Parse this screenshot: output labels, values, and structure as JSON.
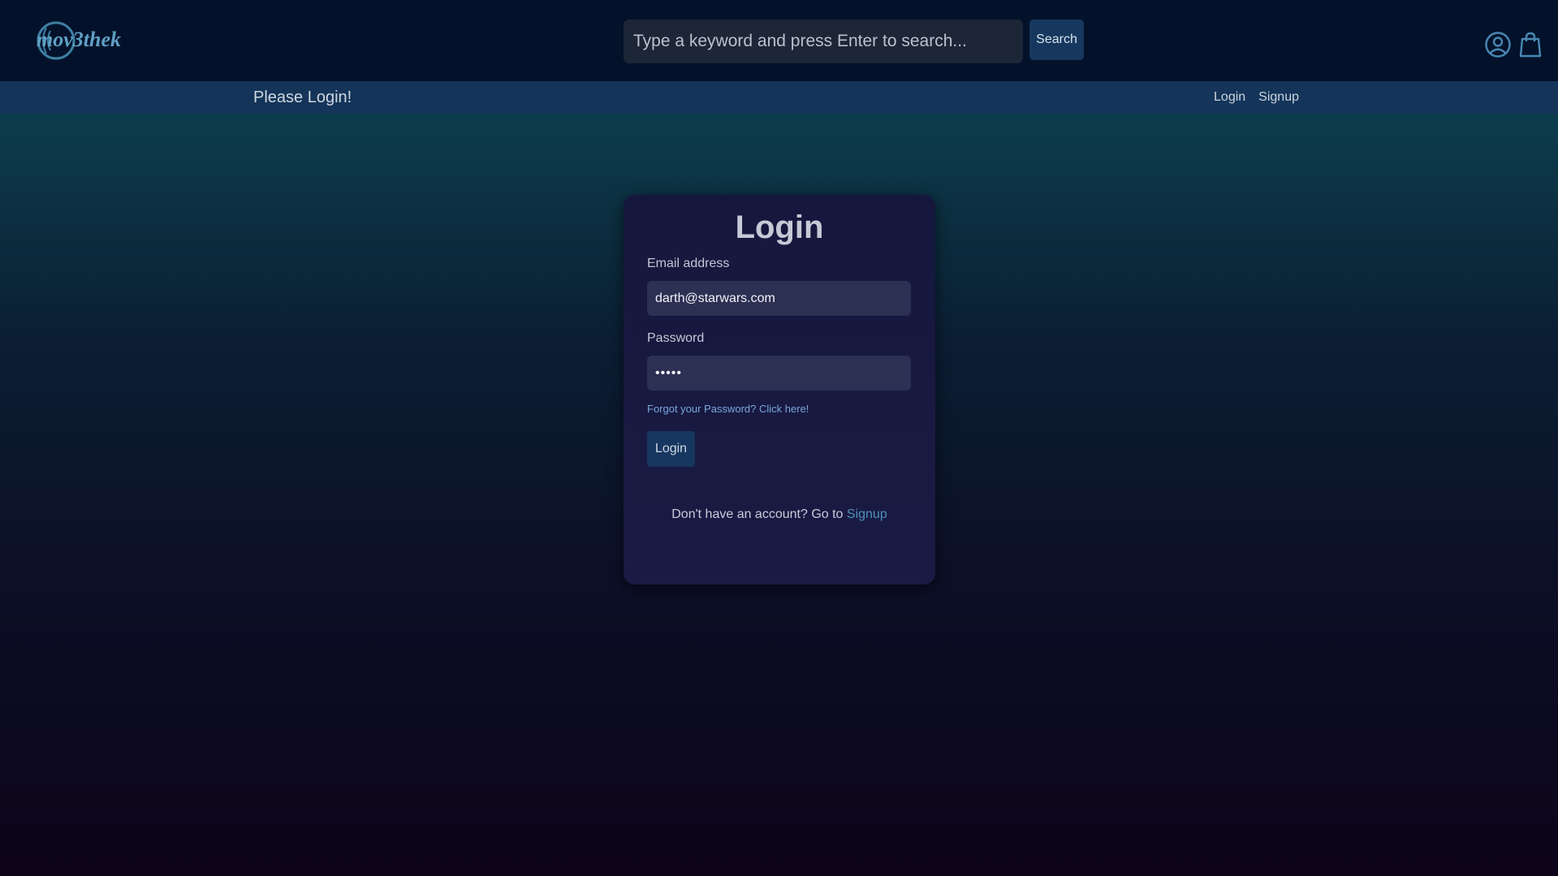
{
  "header": {
    "logo_text": "mov3thek",
    "search": {
      "placeholder": "Type a keyword and press Enter to search...",
      "value": ""
    },
    "search_button_label": "Search",
    "icons": [
      "user-circle-icon",
      "shopping-bag-icon"
    ]
  },
  "subbar": {
    "title": "Please Login!",
    "links": [
      "Login",
      "Signup"
    ]
  },
  "login_card": {
    "title": "Login",
    "email_label": "Email address",
    "email_value": "darth@starwars.com",
    "password_label": "Password",
    "password_value": "•••••",
    "forgot_link": "Forgot your Password? Click here!",
    "login_button": "Login",
    "signup_prompt": "Don't have an account? Go to",
    "signup_link": "Signup"
  },
  "colors": {
    "header_bg": "#03122a",
    "subbar_bg": "#143459",
    "card_bg": "#17183f",
    "accent_link": "#4f8fb9",
    "button_bg": "#173660"
  }
}
